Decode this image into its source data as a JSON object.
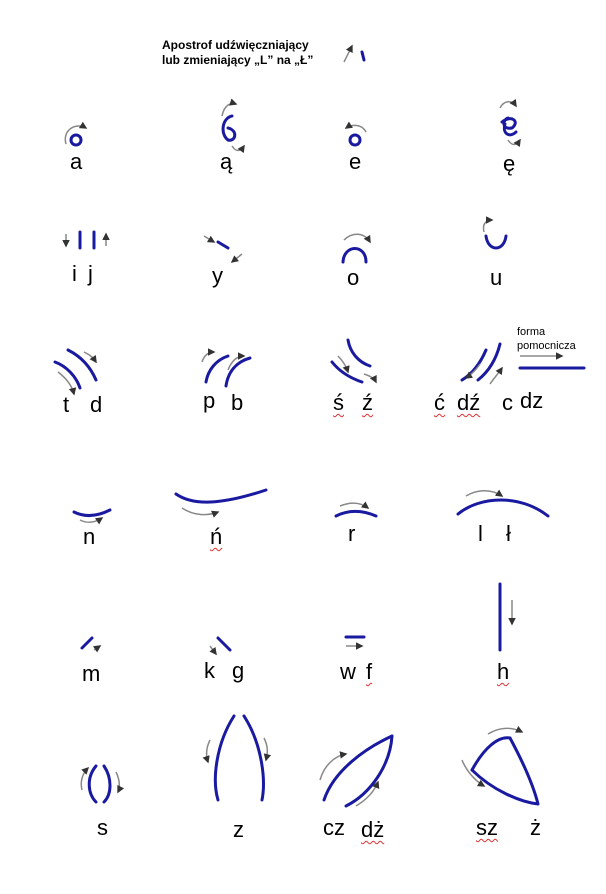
{
  "header": {
    "line1": "Apostrof udźwięczniający",
    "line2": "lub zmieniający „L” na „Ł”"
  },
  "note": {
    "line1": "forma",
    "line2": "pomocnicza"
  },
  "labels": {
    "a": "a",
    "a_ogonek": "ą",
    "e": "e",
    "e_ogonek": "ę",
    "i": "i",
    "j": "j",
    "y": "y",
    "o": "o",
    "u": "u",
    "t": "t",
    "d": "d",
    "p": "p",
    "b": "b",
    "s_acute": "ś",
    "z_acute": "ź",
    "c_acute": "ć",
    "dz_acute": "dź",
    "c": "c",
    "dz": "dz",
    "n": "n",
    "n_acute": "ń",
    "r": "r",
    "l": "l",
    "l_stroke": "ł",
    "m": "m",
    "k": "k",
    "g": "g",
    "w": "w",
    "f": "f",
    "h": "h",
    "s": "s",
    "z": "z",
    "cz": "cz",
    "dz_dot": "dż",
    "sz": "sz",
    "z_dot": "ż"
  },
  "colors": {
    "stroke": "#1a1aa0",
    "arrow": "#888888",
    "arrowhead": "#333333",
    "spellcheck": "#e03030"
  }
}
